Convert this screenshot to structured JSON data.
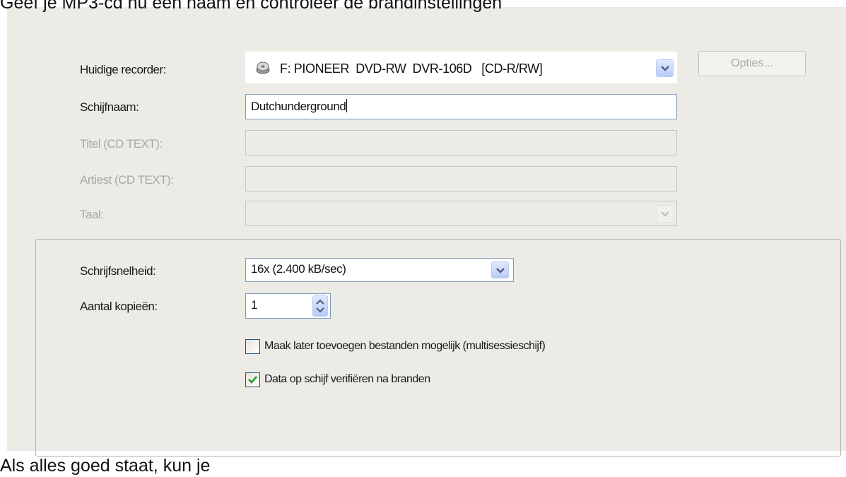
{
  "caption_top": "Geef je MP3-cd nu een naam en controleer de brandinstellingen",
  "caption_bottom": "Als alles goed staat, kun je",
  "recorder": {
    "label": "Huidige recorder:",
    "value": "F: PIONEER  DVD-RW  DVR-106D   [CD-R/RW]",
    "icon": "disc-drive-icon",
    "options_button": "Opties..."
  },
  "disc_name": {
    "label": "Schijfnaam:",
    "value": "Dutchunderground"
  },
  "title": {
    "label": "Titel (CD TEXT):",
    "value": ""
  },
  "artist": {
    "label": "Artiest (CD TEXT):",
    "value": ""
  },
  "language": {
    "label": "Taal:",
    "value": ""
  },
  "write_speed": {
    "label": "Schrijfsnelheid:",
    "value": "16x (2.400 kB/sec)"
  },
  "copies": {
    "label": "Aantal kopieën:",
    "value": "1"
  },
  "multisession": {
    "label": "Maak later toevoegen bestanden mogelijk (multisessieschijf)",
    "checked": false
  },
  "verify": {
    "label": "Data op schijf verifiëren na branden",
    "checked": true
  },
  "colors": {
    "accent": "#316ac5",
    "check": "#21a121",
    "dialog_bg": "#ecebe6"
  }
}
